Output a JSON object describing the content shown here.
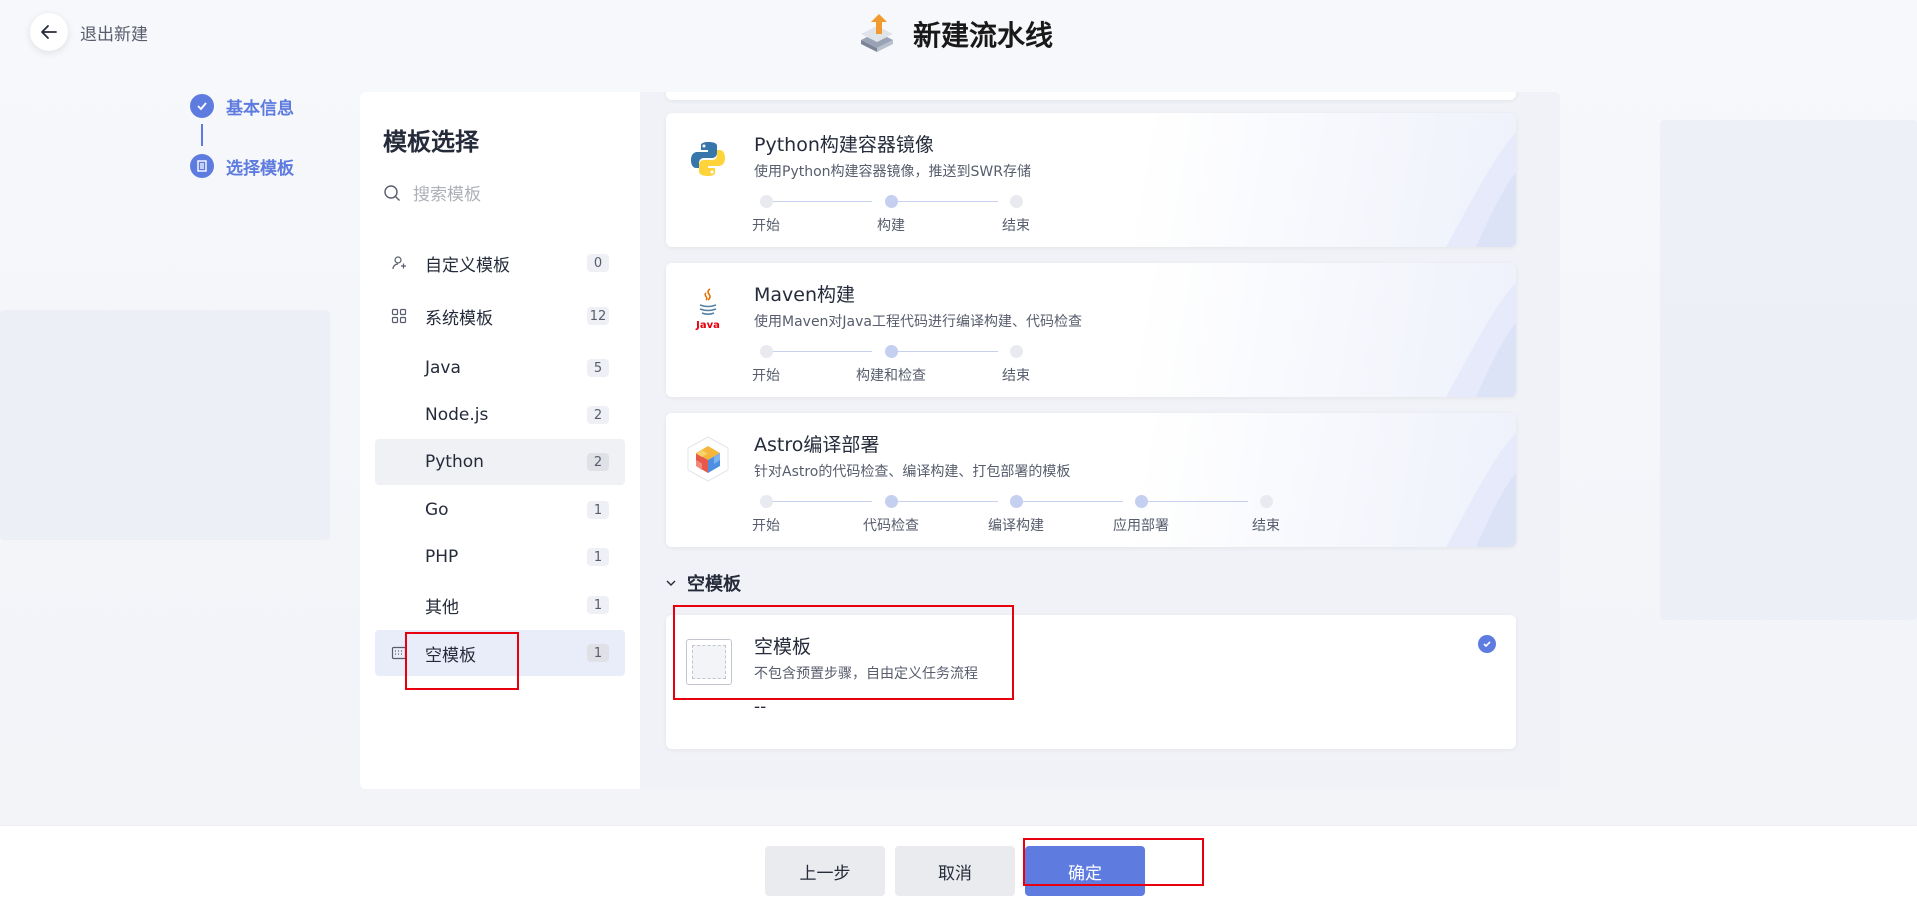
{
  "header": {
    "exit_label": "退出新建",
    "page_title": "新建流水线"
  },
  "steps": [
    {
      "label": "基本信息",
      "state": "done"
    },
    {
      "label": "选择模板",
      "state": "current"
    }
  ],
  "sidebar": {
    "title": "模板选择",
    "search_placeholder": "搜索模板",
    "items": [
      {
        "label": "自定义模板",
        "count": "0",
        "icon": "user-template-icon"
      },
      {
        "label": "系统模板",
        "count": "12",
        "icon": "grid-icon"
      },
      {
        "label": "Java",
        "count": "5"
      },
      {
        "label": "Node.js",
        "count": "2"
      },
      {
        "label": "Python",
        "count": "2",
        "state": "hovered"
      },
      {
        "label": "Go",
        "count": "1"
      },
      {
        "label": "PHP",
        "count": "1"
      },
      {
        "label": "其他",
        "count": "1"
      },
      {
        "label": "空模板",
        "count": "1",
        "icon": "blank-template-icon",
        "state": "selected"
      }
    ]
  },
  "templates": [
    {
      "title": "Python构建容器镜像",
      "description": "使用Python构建容器镜像，推送到SWR存储",
      "icon": "python-icon",
      "stages": [
        "开始",
        "构建",
        "结束"
      ]
    },
    {
      "title": "Maven构建",
      "description": "使用Maven对Java工程代码进行编译构建、代码检查",
      "icon": "java-icon",
      "icon_text": "Java",
      "stages": [
        "开始",
        "构建和检查",
        "结束"
      ]
    },
    {
      "title": "Astro编译部署",
      "description": "针对Astro的代码检查、编译构建、打包部署的模板",
      "icon": "astro-cube-icon",
      "stages": [
        "开始",
        "代码检查",
        "编译构建",
        "应用部署",
        "结束"
      ]
    }
  ],
  "blank_section": {
    "label": "空模板",
    "card": {
      "title": "空模板",
      "description": "不包含预置步骤，自由定义任务流程",
      "stages_text": "--",
      "selected": true
    }
  },
  "footer": {
    "prev": "上一步",
    "cancel": "取消",
    "confirm": "确定"
  },
  "colors": {
    "accent": "#5e7ce0",
    "highlight": "#e8000e"
  }
}
